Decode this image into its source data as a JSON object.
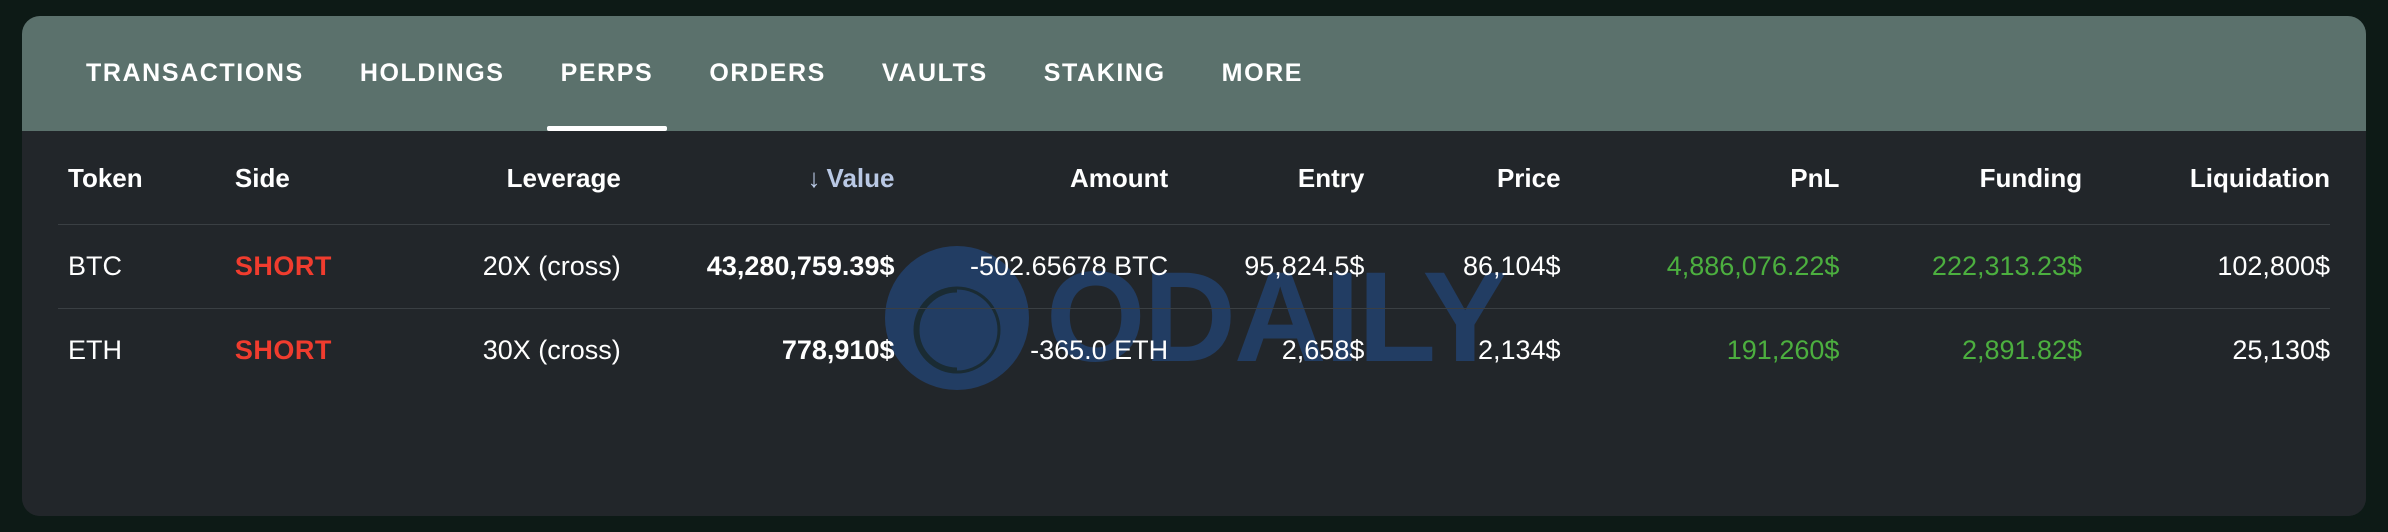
{
  "theme": {
    "page_background": "#0d1a16",
    "card_background": "#22262a",
    "tabbar_background": "#5b716c",
    "accent_short": "#f03c2e",
    "accent_positive": "#4caf3f",
    "sorted_header": "#b9c8e4",
    "watermark_color": "#223d63",
    "row_divider": "#3a3f43"
  },
  "tabs": [
    {
      "label": "TRANSACTIONS",
      "active": false
    },
    {
      "label": "HOLDINGS",
      "active": false
    },
    {
      "label": "PERPS",
      "active": true
    },
    {
      "label": "ORDERS",
      "active": false
    },
    {
      "label": "VAULTS",
      "active": false
    },
    {
      "label": "STAKING",
      "active": false
    },
    {
      "label": "MORE",
      "active": false
    }
  ],
  "watermark": {
    "text": "ODAILY",
    "mark": "odaily-logo-mark"
  },
  "table": {
    "sort": {
      "column": "Value",
      "direction": "desc",
      "arrow": "↓"
    },
    "headers": {
      "token": "Token",
      "side": "Side",
      "leverage": "Leverage",
      "value": "Value",
      "amount": "Amount",
      "entry": "Entry",
      "price": "Price",
      "pnl": "PnL",
      "funding": "Funding",
      "liquidation": "Liquidation"
    },
    "rows": [
      {
        "token": "BTC",
        "side": "SHORT",
        "leverage": "20X (cross)",
        "value": "43,280,759.39$",
        "amount": "-502.65678 BTC",
        "entry": "95,824.5$",
        "price": "86,104$",
        "pnl": "4,886,076.22$",
        "funding": "222,313.23$",
        "liquidation": "102,800$"
      },
      {
        "token": "ETH",
        "side": "SHORT",
        "leverage": "30X (cross)",
        "value": "778,910$",
        "amount": "-365.0 ETH",
        "entry": "2,658$",
        "price": "2,134$",
        "pnl": "191,260$",
        "funding": "2,891.82$",
        "liquidation": "25,130$"
      }
    ]
  }
}
